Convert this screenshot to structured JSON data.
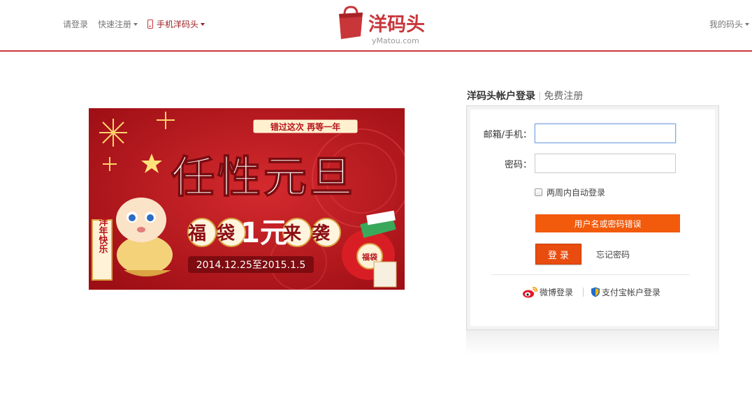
{
  "header": {
    "login_link": "请登录",
    "register_link": "快速注册",
    "mobile_link": "手机洋码头",
    "my_account": "我的码头",
    "logo_text": "洋码头",
    "logo_sub": "yMatou.com"
  },
  "banner": {
    "slogan": "错过这次 再等一年",
    "headline": "任性元旦",
    "promo": "福袋1元来袭",
    "promo_prefix": "福袋",
    "promo_price": "1元",
    "promo_suffix": "来袭",
    "dates": "2014.12.25至2015.1.5",
    "scroll_text": "洋年快乐",
    "bag_label": "福袋"
  },
  "login": {
    "title": "洋码头帐户登录",
    "separator": "|",
    "free_register": "免费注册",
    "email_label": "邮箱/手机：",
    "email_value": "",
    "password_label": "密码：",
    "password_value": "",
    "remember_label": "两周内自动登录",
    "remember_checked": false,
    "error_message": "用户名或密码错误",
    "login_button": "登 录",
    "forgot_password": "忘记密码",
    "weibo_login": "微博登录",
    "alipay_login": "支付宝帐户登录"
  },
  "colors": {
    "brand_red": "#c8363a",
    "error_orange": "#f25a0c",
    "button_orange": "#e84c0e",
    "banner_red": "#b8151c"
  }
}
